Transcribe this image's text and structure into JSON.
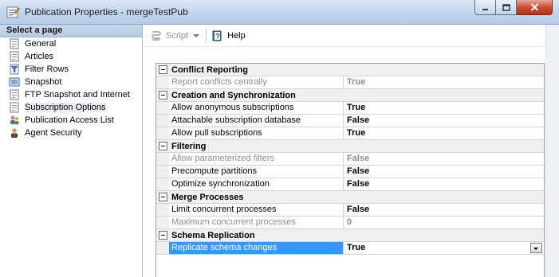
{
  "window": {
    "title": "Publication Properties - mergeTestPub"
  },
  "left_pane": {
    "header": "Select a page",
    "items": [
      {
        "label": "General",
        "icon": "page-icon"
      },
      {
        "label": "Articles",
        "icon": "page-icon"
      },
      {
        "label": "Filter Rows",
        "icon": "filter-icon"
      },
      {
        "label": "Snapshot",
        "icon": "snapshot-icon"
      },
      {
        "label": "FTP Snapshot and Internet",
        "icon": "page-icon"
      },
      {
        "label": "Subscription Options",
        "icon": "page-icon",
        "selected": true
      },
      {
        "label": "Publication Access List",
        "icon": "users-icon"
      },
      {
        "label": "Agent Security",
        "icon": "agent-icon"
      }
    ]
  },
  "toolbar": {
    "script_label": "Script",
    "help_label": "Help"
  },
  "grid": {
    "categories": [
      {
        "name": "Conflict Reporting",
        "rows": [
          {
            "name": "Report conflicts centrally",
            "value": "True",
            "disabled": true
          }
        ]
      },
      {
        "name": "Creation and Synchronization",
        "rows": [
          {
            "name": "Allow anonymous subscriptions",
            "value": "True"
          },
          {
            "name": "Attachable subscription database",
            "value": "False"
          },
          {
            "name": "Allow pull subscriptions",
            "value": "True"
          }
        ]
      },
      {
        "name": "Filtering",
        "rows": [
          {
            "name": "Allow parameterized filters",
            "value": "False",
            "disabled": true
          },
          {
            "name": "Precompute partitions",
            "value": "False"
          },
          {
            "name": "Optimize synchronization",
            "value": "False"
          }
        ]
      },
      {
        "name": "Merge Processes",
        "rows": [
          {
            "name": "Limit concurrent processes",
            "value": "False"
          },
          {
            "name": "Maximum concurrent processes",
            "value": "0",
            "disabled": true
          }
        ]
      },
      {
        "name": "Schema Replication",
        "rows": [
          {
            "name": "Replicate schema changes",
            "value": "True",
            "selected": true
          }
        ]
      }
    ]
  }
}
